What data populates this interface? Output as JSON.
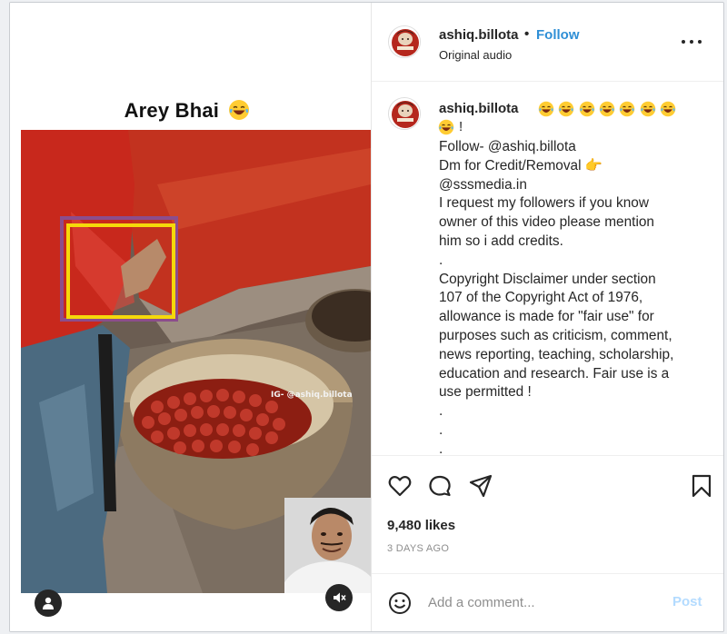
{
  "media": {
    "title": "Arey Bhai",
    "title_emoji": "laughing-tears-emoji",
    "watermark": "IG- @ashiq.billota",
    "user_tag_icon": "person-icon",
    "mute_icon": "speaker-muted-icon"
  },
  "header": {
    "username": "ashiq.billota",
    "separator": "•",
    "follow_label": "Follow",
    "audio": "Original audio",
    "more_icon": "more-horizontal-icon"
  },
  "caption": {
    "username": "ashiq.billota",
    "emoji": "laughing-tears-emoji",
    "emoji_count": 8,
    "exclamation": "!",
    "lines": [
      "Follow- @ashiq.billota",
      "Dm for Credit/Removal 👉",
      "@sssmedia.in",
      "I request my followers if you know",
      "owner of this video please mention",
      "him so i add credits.",
      ".",
      "Copyright Disclaimer under section",
      "107 of the Copyright Act of 1976,",
      "allowance is made for \"fair use\" for",
      "purposes such as criticism, comment,",
      "news reporting, teaching, scholarship,",
      "education and research. Fair use is a",
      "use permitted !",
      ".",
      ".",
      "."
    ]
  },
  "actions": {
    "like_icon": "heart-icon",
    "comment_icon": "comment-icon",
    "share_icon": "send-icon",
    "save_icon": "bookmark-icon",
    "likes": "9,480 likes",
    "date": "3 DAYS AGO"
  },
  "comment": {
    "emoji_icon": "smiley-icon",
    "placeholder": "Add a comment...",
    "post_label": "Post"
  },
  "colors": {
    "follow": "#2f8fd6",
    "post_disabled": "#b3dbff",
    "selection_outer": "#8c4d8c",
    "selection_inner": "#f5d90a"
  }
}
